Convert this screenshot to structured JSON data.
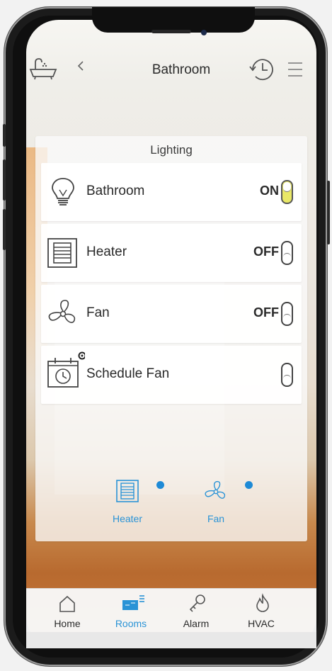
{
  "header": {
    "title": "Bathroom",
    "back_icon": "chevron-left-icon",
    "left_icon": "bathtub-icon",
    "history_icon": "history-icon",
    "menu_icon": "menu-icon"
  },
  "panel": {
    "title": "Lighting",
    "rows": [
      {
        "label": "Bathroom",
        "state": "ON",
        "toggle_on": true,
        "icon": "bulb-icon"
      },
      {
        "label": "Heater",
        "state": "OFF",
        "toggle_on": false,
        "icon": "heater-icon"
      },
      {
        "label": "Fan",
        "state": "OFF",
        "toggle_on": false,
        "icon": "fan-icon"
      },
      {
        "label": "Schedule Fan",
        "state": "",
        "toggle_on": false,
        "icon": "schedule-icon"
      }
    ],
    "quick": [
      {
        "label": "Heater",
        "icon": "heater-icon"
      },
      {
        "label": "Fan",
        "icon": "fan-icon"
      }
    ]
  },
  "tabs": [
    {
      "label": "Home",
      "icon": "home-icon",
      "active": false
    },
    {
      "label": "Rooms",
      "icon": "rooms-icon",
      "active": true
    },
    {
      "label": "Alarm",
      "icon": "key-icon",
      "active": false
    },
    {
      "label": "HVAC",
      "icon": "flame-icon",
      "active": false
    }
  ],
  "colors": {
    "accent": "#2a93d6",
    "toggle_on": "#e9e867"
  }
}
